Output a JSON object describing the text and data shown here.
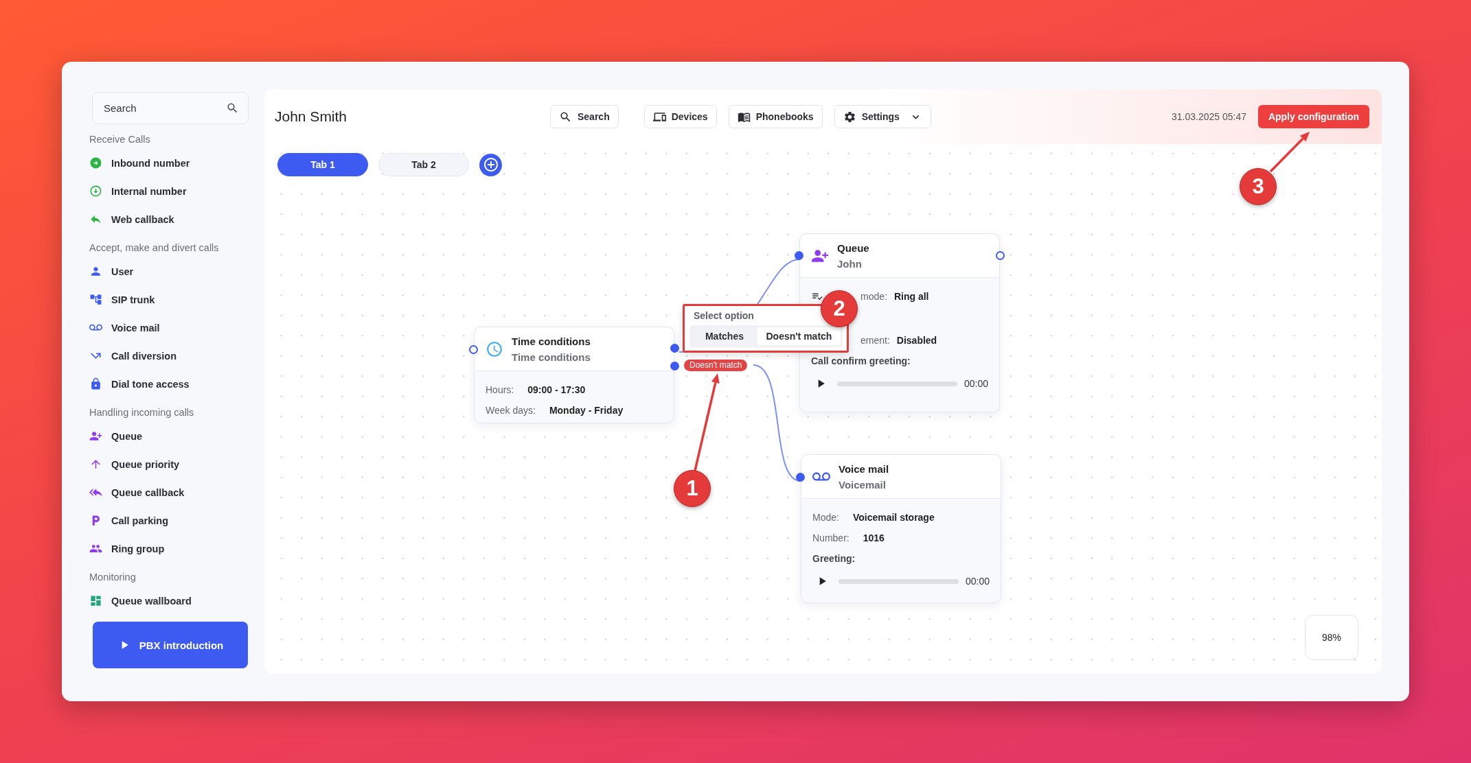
{
  "sidebar": {
    "search": {
      "placeholder": "Search"
    },
    "sections": [
      {
        "title": "Receive Calls",
        "items": [
          {
            "label": "Inbound number"
          },
          {
            "label": "Internal number"
          },
          {
            "label": "Web callback"
          }
        ]
      },
      {
        "title": "Accept, make and divert calls",
        "items": [
          {
            "label": "User"
          },
          {
            "label": "SIP trunk"
          },
          {
            "label": "Voice mail"
          },
          {
            "label": "Call diversion"
          },
          {
            "label": "Dial tone access"
          }
        ]
      },
      {
        "title": "Handling incoming calls",
        "items": [
          {
            "label": "Queue"
          },
          {
            "label": "Queue priority"
          },
          {
            "label": "Queue callback"
          },
          {
            "label": "Call parking"
          },
          {
            "label": "Ring group"
          }
        ]
      },
      {
        "title": "Monitoring",
        "items": [
          {
            "label": "Queue wallboard"
          }
        ]
      }
    ],
    "intro_button": "PBX introduction"
  },
  "header": {
    "title": "John Smith",
    "buttons": [
      {
        "label": "Search",
        "dropdown": false
      },
      {
        "label": "Devices",
        "dropdown": false
      },
      {
        "label": "Phonebooks",
        "dropdown": false
      },
      {
        "label": "Settings",
        "dropdown": true
      }
    ],
    "datetime": "31.03.2025 05:47",
    "apply_button": "Apply configuration"
  },
  "tabs": [
    {
      "label": "Tab 1",
      "selected": true
    },
    {
      "label": "Tab 2",
      "selected": false
    }
  ],
  "canvas": {
    "nodes": [
      {
        "kind": "time_conditions",
        "title": "Time conditions",
        "subtitle": "Time conditions",
        "ports": [
          {
            "connected": false
          },
          {
            "connected": true
          },
          {
            "connected": true
          }
        ],
        "rows": [
          {
            "kind": "field",
            "label": "Hours:",
            "value": "09:00 - 17:30"
          },
          {
            "kind": "field",
            "label": "Week days:",
            "value": "Monday - Friday"
          }
        ]
      },
      {
        "kind": "queue",
        "title": "Queue",
        "subtitle": "John",
        "ports": [
          {
            "connected": true
          },
          {
            "connected": false
          }
        ],
        "rows": [
          {
            "kind": "covered",
            "icon": true,
            "label": "mode:",
            "value": "Ring all"
          },
          {
            "kind": "covered",
            "icon": false,
            "label": "ement:",
            "value": "Disabled"
          },
          {
            "kind": "heading",
            "label": "Call confirm greeting:"
          },
          {
            "kind": "player",
            "time": "00:00"
          }
        ]
      },
      {
        "kind": "voicemail",
        "title": "Voice mail",
        "subtitle": "Voicemail",
        "ports": [
          {
            "connected": true
          }
        ],
        "rows": [
          {
            "kind": "field",
            "label": "Mode:",
            "value": "Voicemail storage"
          },
          {
            "kind": "field",
            "label": "Number:",
            "value": "1016"
          },
          {
            "kind": "heading",
            "label": "Greeting:"
          },
          {
            "kind": "player",
            "time": "00:00"
          }
        ]
      }
    ],
    "popup": {
      "title": "Select option",
      "options": [
        {
          "label": "Matches",
          "selected": false
        },
        {
          "label": "Doesn't match",
          "selected": true
        }
      ]
    },
    "edge_label": "Doesn't match",
    "zoom": "98%"
  },
  "annotations": [
    {
      "number": "1"
    },
    {
      "number": "2"
    },
    {
      "number": "3"
    }
  ]
}
